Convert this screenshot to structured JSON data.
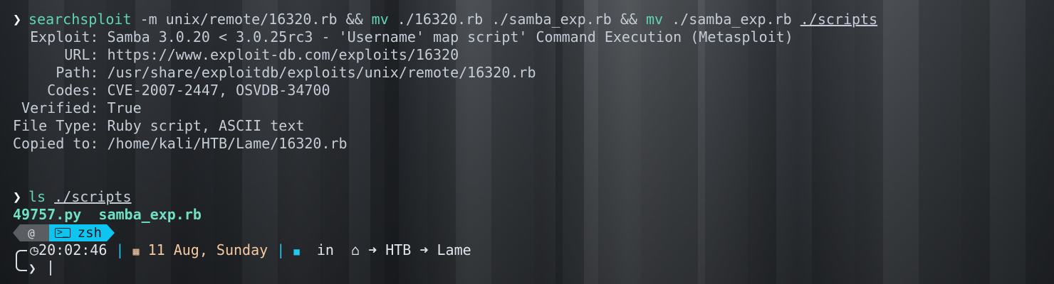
{
  "terminal": {
    "cmd1": {
      "name": "searchsploit",
      "args": " -m unix/remote/16320.rb && ",
      "mv1": "mv",
      "mv1_args": " ./16320.rb ./samba_exp.rb && ",
      "mv2": "mv",
      "mv2_args": " ./samba_exp.rb ",
      "dest": "./scripts"
    },
    "output": [
      "  Exploit: Samba 3.0.20 < 3.0.25rc3 - 'Username' map script' Command Execution (Metasploit)",
      "      URL: https://www.exploit-db.com/exploits/16320",
      "     Path: /usr/share/exploitdb/exploits/unix/remote/16320.rb",
      "    Codes: CVE-2007-2447, OSVDB-34700",
      " Verified: True",
      "File Type: Ruby script, ASCII text",
      "Copied to: /home/kali/HTB/Lame/16320.rb"
    ],
    "cmd2": {
      "name": "ls",
      "arg": "./scripts"
    },
    "files": [
      "49757.py",
      "samba_exp.rb"
    ],
    "prompt": {
      "os_icon": "debian-icon",
      "shell": "zsh",
      "time": "20:02:46",
      "sep": "|",
      "date": "11 Aug, Sunday",
      "in_label": "in",
      "path": [
        "HTB",
        "Lame"
      ],
      "arrow": "➜",
      "input_char": "❯"
    }
  },
  "colors": {
    "command": "#5ed6b6",
    "file": "#6fe0c4",
    "date": "#f5c9a0",
    "accent": "#23c6ef",
    "shell_segment": "#0ec4f0"
  }
}
